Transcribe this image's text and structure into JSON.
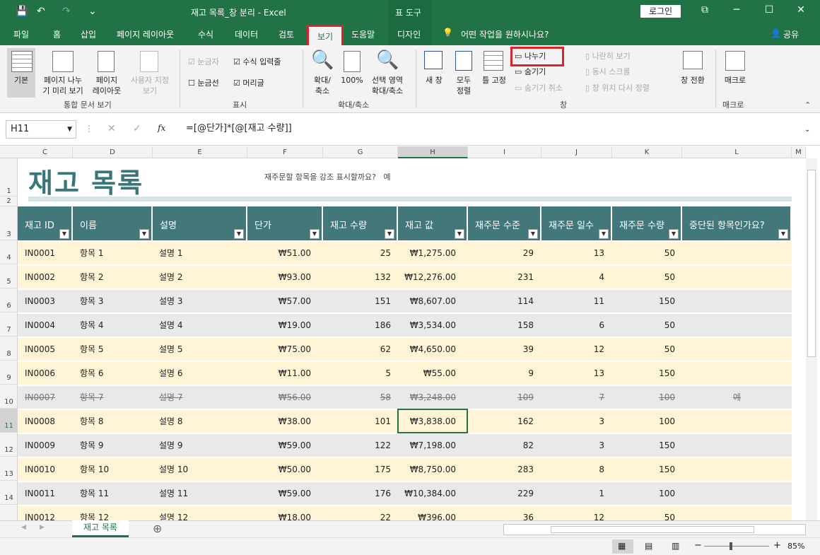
{
  "window": {
    "title": "재고 목록_창 분리 - Excel",
    "tool_label": "표 도구",
    "login": "로그인"
  },
  "qat": {
    "save": "💾",
    "undo": "↶",
    "redo": "↷",
    "more": "⌄"
  },
  "winbtns": {
    "restore": "⧉",
    "min": "─",
    "max": "☐",
    "close": "✕"
  },
  "tabs": [
    "파일",
    "홈",
    "삽입",
    "페이지 레이아웃",
    "수식",
    "데이터",
    "검토",
    "보기",
    "도움말",
    "디자인"
  ],
  "tell_me": "어떤 작업을 원하시나요?",
  "share": "공유",
  "ribbon": {
    "workbook_views": {
      "normal": "기본",
      "page_break": "페이지 나누\n기 미리 보기",
      "page_layout": "페이지\n레이아웃",
      "custom": "사용자 지정\n보기",
      "label": "통합 문서 보기"
    },
    "show": {
      "ruler": "눈금자",
      "formula_bar": "수식 입력줄",
      "gridlines": "눈금선",
      "headings": "머리글",
      "label": "표시"
    },
    "zoom": {
      "zoom": "확대/\n축소",
      "z100": "100%",
      "selection": "선택 영역\n확대/축소",
      "label": "확대/축소"
    },
    "window": {
      "new": "새 창",
      "arrange": "모두\n정렬",
      "freeze": "틀 고정",
      "split": "나누기",
      "hide": "숨기기",
      "unhide": "숨기기 취소",
      "side": "나란히 보기",
      "sync": "동시 스크롤",
      "reset": "창 위치 다시 정렬",
      "switch": "창 전환",
      "label": "창"
    },
    "macro": {
      "macro": "매크로",
      "label": "매크로"
    }
  },
  "formula": {
    "namebox": "H11",
    "fx": "fx",
    "value": "=[@단가]*[@[재고 수량]]"
  },
  "columns": [
    "C",
    "D",
    "E",
    "F",
    "G",
    "H",
    "I",
    "J",
    "K",
    "L",
    "M"
  ],
  "sheet": {
    "title": "재고 목록",
    "question": "재주문할 항목을 강조 표시할까요?",
    "answer": "예"
  },
  "headers": [
    "재고 ID",
    "이름",
    "설명",
    "단가",
    "재고 수량",
    "재고 값",
    "재주문 수준",
    "재주문 일수",
    "재주문 수량",
    "중단된 항목인가요?"
  ],
  "rows": [
    [
      "IN0001",
      "항목 1",
      "설명 1",
      "₩51.00",
      "25",
      "₩1,275.00",
      "29",
      "13",
      "50",
      ""
    ],
    [
      "IN0002",
      "항목 2",
      "설명 2",
      "₩93.00",
      "132",
      "₩12,276.00",
      "231",
      "4",
      "50",
      ""
    ],
    [
      "IN0003",
      "항목 3",
      "설명 3",
      "₩57.00",
      "151",
      "₩8,607.00",
      "114",
      "11",
      "150",
      ""
    ],
    [
      "IN0004",
      "항목 4",
      "설명 4",
      "₩19.00",
      "186",
      "₩3,534.00",
      "158",
      "6",
      "50",
      ""
    ],
    [
      "IN0005",
      "항목 5",
      "설명 5",
      "₩75.00",
      "62",
      "₩4,650.00",
      "39",
      "12",
      "50",
      ""
    ],
    [
      "IN0006",
      "항목 6",
      "설명 6",
      "₩11.00",
      "5",
      "₩55.00",
      "9",
      "13",
      "150",
      ""
    ],
    [
      "IN0007",
      "항목 7",
      "설명 7",
      "₩56.00",
      "58",
      "₩3,248.00",
      "109",
      "7",
      "100",
      "예"
    ],
    [
      "IN0008",
      "항목 8",
      "설명 8",
      "₩38.00",
      "101",
      "₩3,838.00",
      "162",
      "3",
      "100",
      ""
    ],
    [
      "IN0009",
      "항목 9",
      "설명 9",
      "₩59.00",
      "122",
      "₩7,198.00",
      "82",
      "3",
      "150",
      ""
    ],
    [
      "IN0010",
      "항목 10",
      "설명 10",
      "₩50.00",
      "175",
      "₩8,750.00",
      "283",
      "8",
      "150",
      ""
    ],
    [
      "IN0011",
      "항목 11",
      "설명 11",
      "₩59.00",
      "176",
      "₩10,384.00",
      "229",
      "1",
      "100",
      ""
    ],
    [
      "IN0012",
      "항목 12",
      "설명 12",
      "₩18.00",
      "22",
      "₩396.00",
      "36",
      "12",
      "50",
      ""
    ]
  ],
  "row_numbers": [
    "1",
    "2",
    "3",
    "4",
    "5",
    "6",
    "7",
    "8",
    "9",
    "10",
    "11",
    "12",
    "13",
    "14"
  ],
  "sheet_tab": "재고 목록",
  "zoom_level": "85%"
}
